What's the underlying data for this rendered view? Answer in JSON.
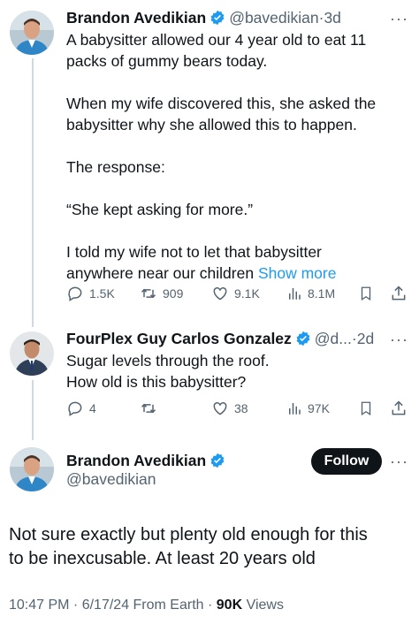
{
  "tweet1": {
    "author_name": "Brandon Avedikian",
    "handle": "@bavedikian",
    "separator": "·",
    "time": "3d",
    "text_lines": [
      "A babysitter allowed our 4 year old to eat 11",
      "packs of gummy bears today.",
      "When my wife discovered this, she asked the",
      "babysitter why she allowed this to happen.",
      "The response:",
      "“She kept asking for more.”",
      "I told my wife not to let that babysitter",
      "anywhere near our children"
    ],
    "show_more": "Show more",
    "replies": "1.5K",
    "reposts": "909",
    "likes": "9.1K",
    "views": "8.1M"
  },
  "tweet2": {
    "author_name": "FourPlex Guy Carlos Gonzalez",
    "handle": "@d...",
    "separator": "·",
    "time": "2d",
    "text_lines": [
      "Sugar levels through the roof.",
      "How old is this babysitter?"
    ],
    "replies": "4",
    "reposts": "",
    "likes": "38",
    "views": "97K"
  },
  "main_tweet": {
    "author_name": "Brandon Avedikian",
    "handle": "@bavedikian",
    "follow_label": "Follow",
    "text_lines": [
      "Not sure exactly but plenty old enough for this",
      "to be inexcusable. At least 20 years old"
    ],
    "timestamp": "10:47 PM · 6/17/24 From Earth ·",
    "views_count": "90K",
    "views_label": "Views"
  },
  "more_glyph": "···",
  "colors": {
    "accent": "#1d9bf0",
    "text": "#0f1419",
    "secondary": "#536471",
    "line": "#cfd9de"
  }
}
